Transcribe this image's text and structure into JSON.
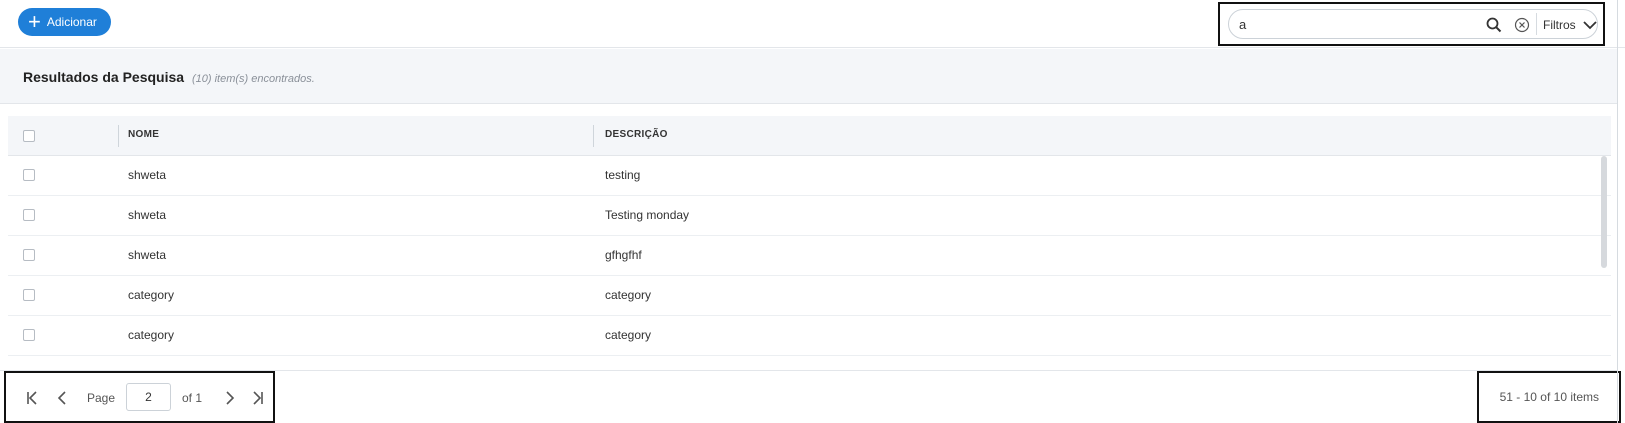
{
  "toolbar": {
    "add_label": "Adicionar",
    "search_value": "a",
    "filters_label": "Filtros"
  },
  "results": {
    "title": "Resultados da Pesquisa",
    "count": "(10) item(s) encontrados."
  },
  "table": {
    "columns": [
      "NOME",
      "DESCRIÇÃO"
    ],
    "rows": [
      {
        "nome": "shweta",
        "descricao": "testing"
      },
      {
        "nome": "shweta",
        "descricao": "Testing monday"
      },
      {
        "nome": "shweta",
        "descricao": "gfhgfhf"
      },
      {
        "nome": "category",
        "descricao": "category"
      },
      {
        "nome": "category",
        "descricao": "category"
      }
    ]
  },
  "pager": {
    "page_label": "Page",
    "page_value": "2",
    "of_label": "of 1",
    "items_text": "51 - 10 of 10 items"
  },
  "colors": {
    "accent": "#1f7fd8",
    "header_bg": "#f4f6f9"
  }
}
